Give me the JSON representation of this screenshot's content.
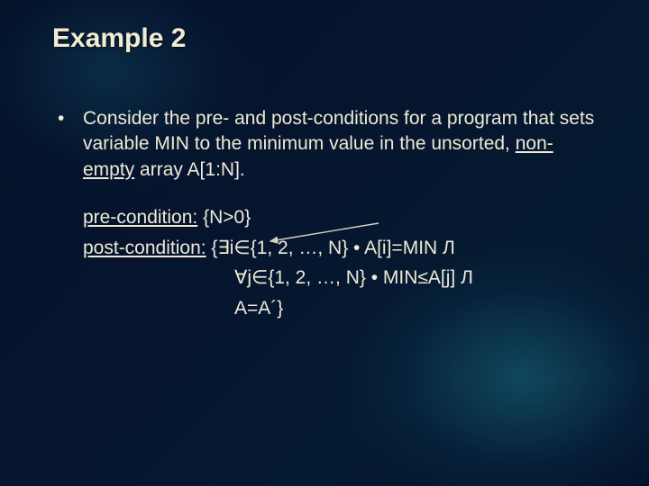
{
  "title": "Example 2",
  "bullet": {
    "prefix": "Consider the pre- and post-conditions for a program that sets variable MIN to the minimum value in the unsorted, ",
    "underlined": "non-empty",
    "suffix": " array A[1:N]."
  },
  "pre": {
    "label": "pre-condition:",
    "body": " {N>0}"
  },
  "post": {
    "label": "post-condition:",
    "line1": " {∃i∈{1, 2, …, N} • A[i]=MIN Л",
    "line2": "∀j∈{1, 2, …, N} • MIN≤A[j] Л",
    "line3": "A=A´}"
  }
}
